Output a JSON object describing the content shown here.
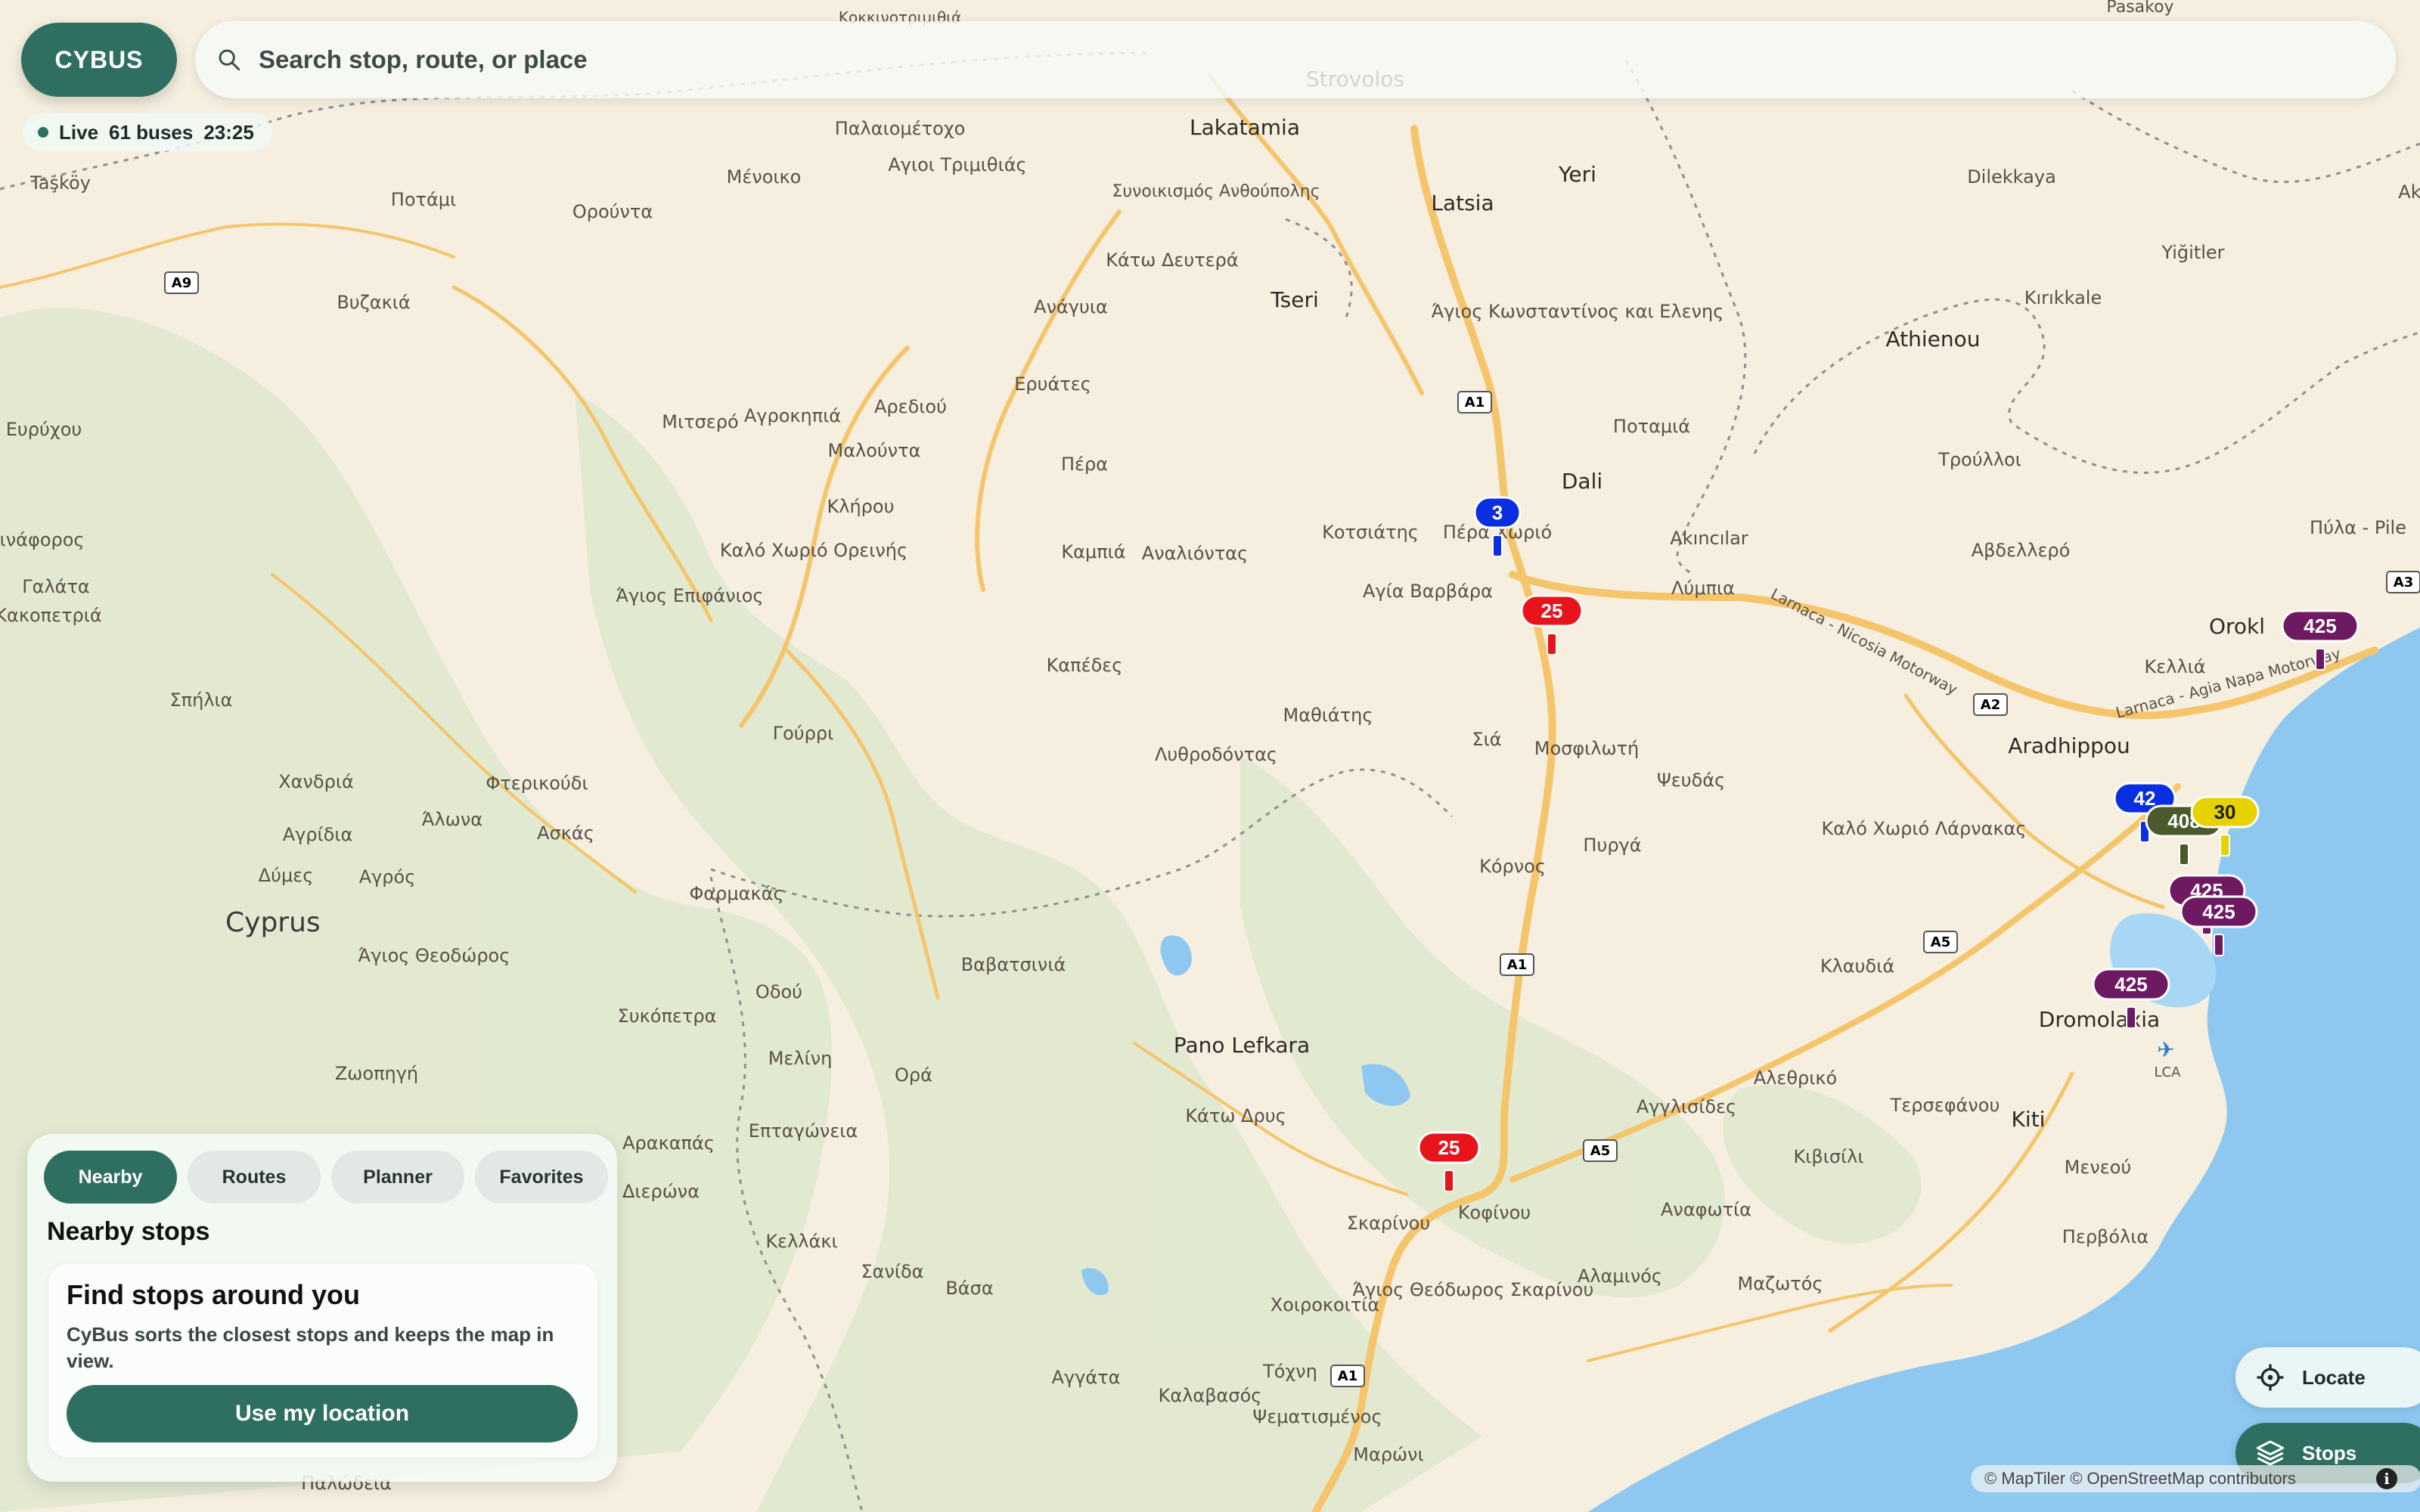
{
  "app": {
    "brand": "CYBUS",
    "search_placeholder": "Search stop, route, or place"
  },
  "status": {
    "live_label": "Live",
    "bus_count": "61 buses",
    "time": "23:25"
  },
  "panel": {
    "tabs": [
      {
        "label": "Nearby",
        "active": true
      },
      {
        "label": "Routes",
        "active": false
      },
      {
        "label": "Planner",
        "active": false
      },
      {
        "label": "Favorites",
        "active": false
      }
    ],
    "title": "Nearby stops",
    "card": {
      "title": "Find stops around you",
      "text": "CyBus sorts the closest stops and keeps the map in view.",
      "button": "Use my location"
    }
  },
  "controls": {
    "locate": "Locate",
    "stops": "Stops"
  },
  "attribution": "© MapTiler © OpenStreetMap contributors",
  "colors": {
    "accent": "#2f6f62",
    "route_red": "#e8141c",
    "route_blue": "#0a2fe0",
    "route_purple": "#6e1a63",
    "route_olive": "#4b5a2c",
    "route_yellow": "#e6d200",
    "sea": "#8ec7f0"
  },
  "buses": [
    {
      "route": "3",
      "color": "#0a2fe0"
    },
    {
      "route": "25",
      "color": "#e8141c"
    },
    {
      "route": "25",
      "color": "#e8141c"
    },
    {
      "route": "425",
      "color": "#6e1a63"
    },
    {
      "route": "42",
      "color": "#0a2fe0"
    },
    {
      "route": "408",
      "color": "#4b5a2c"
    },
    {
      "route": "30",
      "color": "#e6d200"
    },
    {
      "route": "425",
      "color": "#6e1a63"
    },
    {
      "route": "425",
      "color": "#6e1a63"
    },
    {
      "route": "425",
      "color": "#6e1a63"
    }
  ],
  "map_labels": {
    "places": [
      "Κοκκινοτριμιθιά",
      "Pasakoy",
      "Strovolos",
      "Lakatamia",
      "Παλαιομέτοχο",
      "Αγιοι Τριμιθιάς",
      "Μένοικο",
      "Συνοικισμός Ανθούπολης",
      "Latsia",
      "Yeri",
      "Dilekkaya",
      "Akdoğan",
      "Yiğitler",
      "Ποτάμι",
      "Ορούντα",
      "Κάτω Δευτερά",
      "Tseri",
      "Άγιος Κωνσταντίνος και Ελενης",
      "Kırıkkale",
      "Athienou",
      "Βυζακιά",
      "Ανάγυια",
      "Ερυάτες",
      "Αρεδιού",
      "Μαλούντα",
      "Μιτσερό",
      "Αγροκηπιά",
      "Ποταμιά",
      "Τρούλλοι",
      "Πέρα",
      "Κλήρου",
      "Dali",
      "Καλό Χωριό Ορεινής",
      "Καμπιά",
      "Αναλιόντας",
      "Κοτσιάτης",
      "Πέρα Χωριό",
      "Akıncılar",
      "Αβδελλερό",
      "Άγιος Επιφάνιος",
      "Αγία Βαρβάρα",
      "Λύμπια",
      "Καπέδες",
      "Μαθιάτης",
      "Σιά",
      "Μοσφιλωτή",
      "Κελλιά",
      "Σπήλια",
      "Γούρρι",
      "Λυθροδόντας",
      "Ψευδάς",
      "Aradhippou",
      "Χανδριά",
      "Φτερικούδι",
      "Άλωνα",
      "Ασκάς",
      "Αγρίδια",
      "Πυργά",
      "Καλό Χωριό Λάρνακας",
      "Κόρνος",
      "Δύμες",
      "Αγρός",
      "Φαρμακάς",
      "Άγιος Θεοδώρος",
      "Βαβατσινιά",
      "Κλαυδιά",
      "Συκόπετρα",
      "Οδού",
      "Μελίνη",
      "Ορά",
      "Pano Lefkara",
      "Dromolaxia",
      "Ζωοπηγή",
      "Κάτω Δρυς",
      "Αλεθρικό",
      "Αρακαπάς",
      "Επταγώνεια",
      "Αγγλισίδες",
      "Τερσεφάνου",
      "Kiti",
      "Διερώνα",
      "Κοφίνου",
      "Σκαρίνου",
      "Κιβισίλι",
      "Μενεού",
      "Αναφωτία",
      "Κελλάκι",
      "Σανίδα",
      "Βάσα",
      "Άγιος Θεόδωρος Σκαρίνου",
      "Αλαμινός",
      "Μαζωτός",
      "Περβόλια",
      "Χοιροκοιτία",
      "Τόχνη",
      "Αγγάτα",
      "Καλαβασός",
      "Ψεματισμένος",
      "Μαρώνι",
      "Παλώδεια",
      "Γαλάτα",
      "Κακοπετριά",
      "Σινάφορος",
      "Ευρύχου",
      "Taşköy",
      "Πύλα - Pile",
      "Orokl",
      "LCA"
    ],
    "country": "Cyprus",
    "roads": [
      "A1",
      "A1",
      "A1",
      "A1",
      "A2",
      "A3",
      "A5",
      "A5",
      "A9"
    ],
    "motorways": [
      "Larnaca - Nicosia Motorway",
      "Larnaca - Agia Napa Motorway"
    ]
  }
}
